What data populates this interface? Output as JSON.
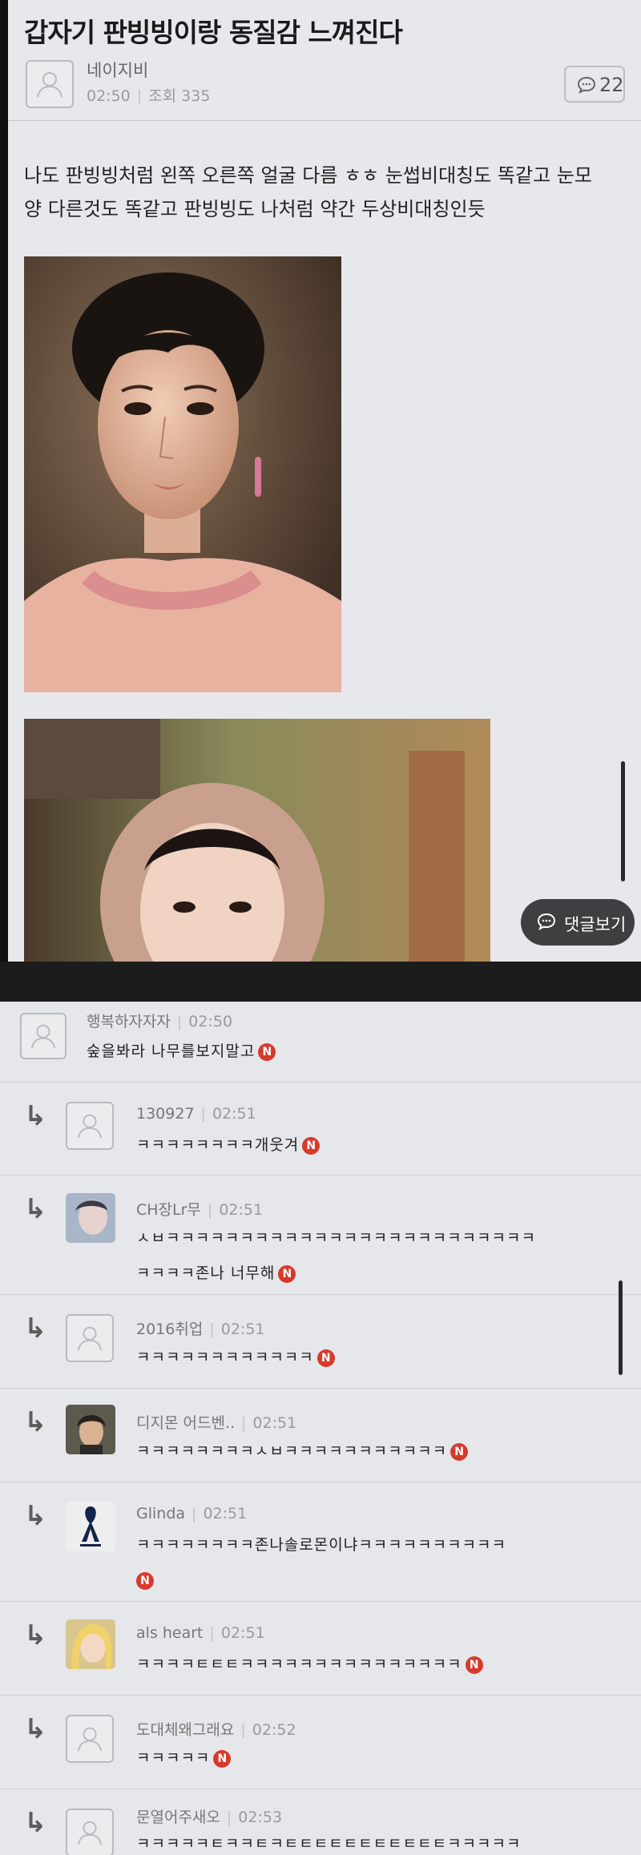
{
  "post": {
    "title": "갑자기 판빙빙이랑 동질감 느껴진다",
    "author": "네이지비",
    "time": "02:50",
    "views": "조회 335",
    "comment_count": "22",
    "body_line1": "나도 판빙빙처럼 왼쪽 오른쪽 얼굴 다름 ㅎㅎ 눈썹비대칭도 똑같고 눈모",
    "body_line2": "양 다른것도 똑같고 판빙빙도 나처럼 약간 두상비대칭인듯"
  },
  "reply_view_label": "댓글보기",
  "n_badge": "N",
  "comments": [
    {
      "name": "행복하자자자",
      "time": "02:50",
      "text": "숲을봐라 나무를보지말고"
    },
    {
      "name": "130927",
      "time": "02:51",
      "text": "ㅋㅋㅋㅋㅋㅋㅋㅋ개웃겨"
    },
    {
      "name": "CH장Lr무",
      "time": "02:51",
      "text1": "ㅅㅂㅋㅋㅋㅋㅋㅋㅋㅋㅋㅋㅋㅋㅋㅋㅋㅋㅋㅋㅋㅋㅋㅋㅋㅋㅋ",
      "text2": "ㅋㅋㅋㅋ존나 너무해"
    },
    {
      "name": "2016취업",
      "time": "02:51",
      "text": "ㅋㅋㅋㅋㅋㅋㅋㅋㅋㅋㅋㅋ"
    },
    {
      "name": "디지몬 어드벤..",
      "time": "02:51",
      "text": "ㅋㅋㅋㅋㅋㅋㅋㅋㅅㅂㅋㅋㅋㅋㅋㅋㅋㅋㅋㅋㅋ"
    },
    {
      "name": "Glinda",
      "time": "02:51",
      "text": "ㅋㅋㅋㅋㅋㅋㅋㅋ존나솔로몬이냐ㅋㅋㅋㅋㅋㅋㅋㅋㅋㅋ"
    },
    {
      "name": "als heart",
      "time": "02:51",
      "text": "ㅋㅋㅋㅋㅌㅌㅌㅋㅋㅋㅋㅋㅋㅋㅋㅋㅋㅋㅋㅋㅋㅋ"
    },
    {
      "name": "도대체왜그래요",
      "time": "02:52",
      "text": "ㅋㅋㅋㅋㅋ"
    },
    {
      "name": "문열어주새오",
      "time": "02:53",
      "text": "ㅋㅋㅋㅋㅋㅌㅋㅋㅌㅋㅌㅌㅌㅌㅌㅌㅌㅌㅌㅌㅌㅋㅋㅋㅋㅋ"
    }
  ],
  "icons": {
    "default_avatar": "person-silhouette-icon",
    "comment": "speech-bubble-icon",
    "reply": "reply-arrow-icon",
    "new_badge": "new-badge-icon"
  },
  "colors": {
    "background": "#e7e8ec",
    "badge_red": "#d63a2d",
    "pill_dark": "#3e3f41"
  }
}
